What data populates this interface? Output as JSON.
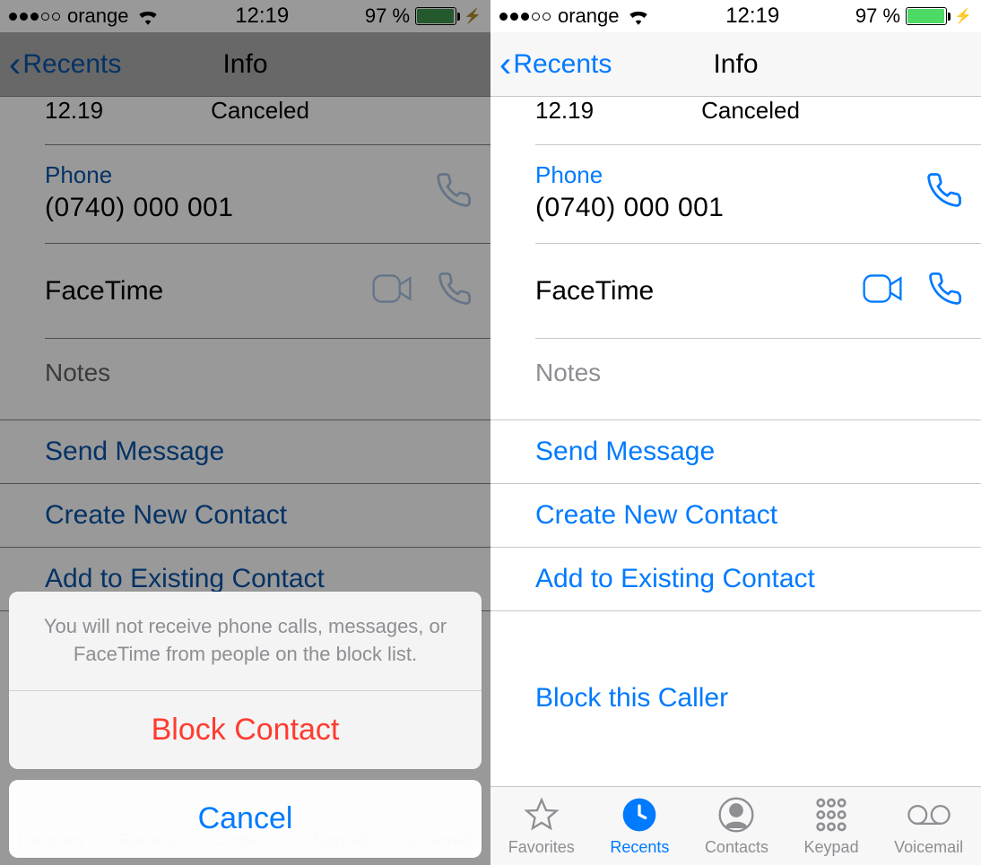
{
  "status": {
    "carrier": "orange",
    "time": "12:19",
    "battery_pct": "97 %",
    "battery_fill_pct": 97
  },
  "nav": {
    "back": "Recents",
    "title": "Info"
  },
  "call": {
    "time": "12.19",
    "status": "Canceled"
  },
  "phone_field": {
    "label": "Phone",
    "value": "(0740) 000 001"
  },
  "facetime": {
    "label": "FaceTime"
  },
  "notes": {
    "label": "Notes"
  },
  "actions": {
    "send_message": "Send Message",
    "create_contact": "Create New Contact",
    "add_existing": "Add to Existing Contact",
    "block_caller": "Block this Caller"
  },
  "sheet": {
    "message": "You will not receive phone calls, messages, or FaceTime from people on the block list.",
    "block": "Block Contact",
    "cancel": "Cancel"
  },
  "tabs": {
    "favorites": "Favorites",
    "recents": "Recents",
    "contacts": "Contacts",
    "keypad": "Keypad",
    "voicemail": "Voicemail"
  }
}
